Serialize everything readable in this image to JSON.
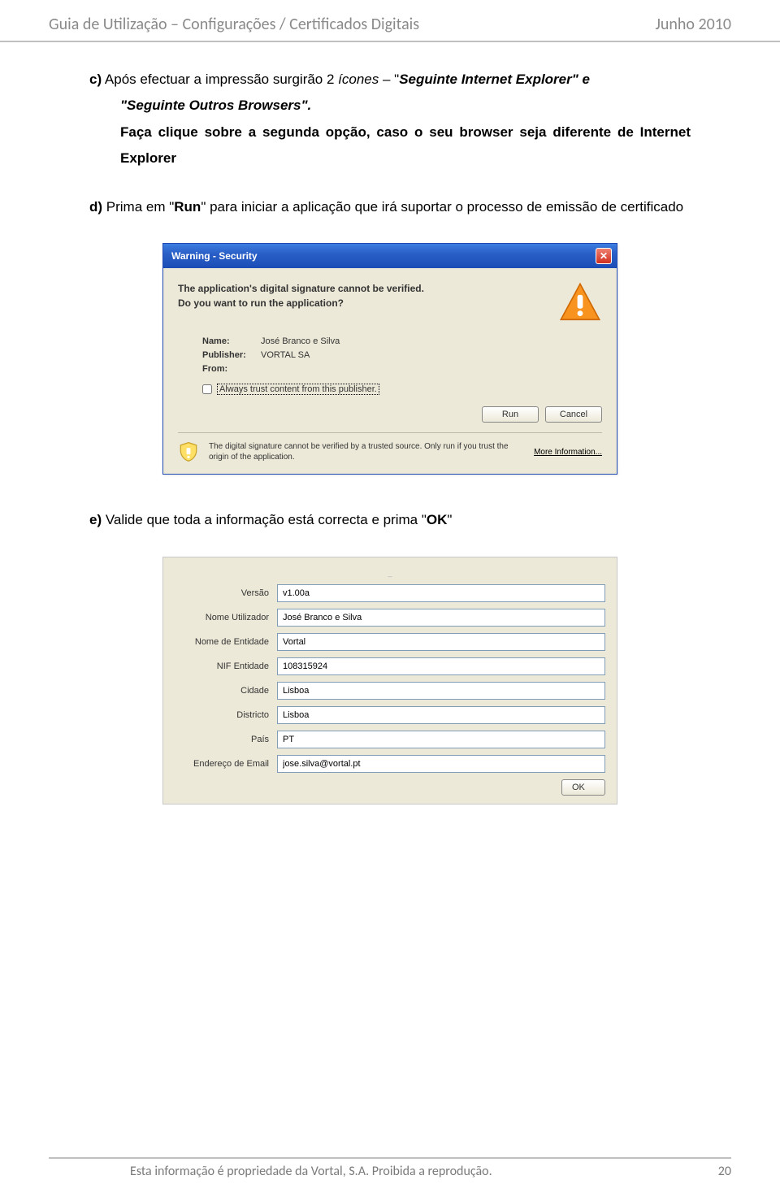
{
  "header": {
    "left": "Guia de Utilização – Configurações / Certificados Digitais",
    "right": "Junho 2010"
  },
  "para_c": {
    "prefix": "c)",
    "t1": " Após efectuar a impressão surgirão 2 ",
    "t2_ital": "ícones",
    "t3": " – \"",
    "t4_bold_ital": "Seguinte Internet Explorer\" e",
    "line2_bold_ital": "\"Seguinte Outros Browsers\".",
    "line3_bold": "Faça clique sobre a segunda opção, caso o seu browser seja diferente de Internet Explorer"
  },
  "para_d": {
    "prefix": "d)",
    "t1": " Prima em \"",
    "t2_bold": "Run",
    "t3": "\" para iniciar a aplicação que irá suportar o processo de emissão de certificado"
  },
  "dialog": {
    "title": "Warning - Security",
    "msg1": "The application's digital signature cannot be verified.",
    "msg2": "Do you want to run the application?",
    "name_label": "Name:",
    "name_value": "José Branco e Silva",
    "publisher_label": "Publisher:",
    "publisher_value": "VORTAL SA",
    "from_label": "From:",
    "from_value": "",
    "always_trust": "Always trust content from this publisher.",
    "run": "Run",
    "cancel": "Cancel",
    "bottom_text": "The digital signature cannot be verified by a trusted source. Only run if you trust the origin of the application.",
    "more": "More Information..."
  },
  "para_e": {
    "prefix": "e)",
    "t1": " Valide que toda a informação está correcta e prima \"",
    "t2_bold": "OK",
    "t3": "\""
  },
  "form": {
    "title_mark": "_",
    "fields": {
      "versao_label": "Versão",
      "versao_value": "v1.00a",
      "nome_util_label": "Nome Utilizador",
      "nome_util_value": "José Branco e Silva",
      "nome_ent_label": "Nome de Entidade",
      "nome_ent_value": "Vortal",
      "nif_label": "NIF Entidade",
      "nif_value": "108315924",
      "cidade_label": "Cidade",
      "cidade_value": "Lisboa",
      "districto_label": "Districto",
      "districto_value": "Lisboa",
      "pais_label": "País",
      "pais_value": "PT",
      "email_label": "Endereço de Email",
      "email_value": "jose.silva@vortal.pt"
    },
    "ok": "OK"
  },
  "footer": {
    "left": "Esta informação é propriedade da Vortal, S.A. Proibida a reprodução.",
    "right": "20"
  }
}
